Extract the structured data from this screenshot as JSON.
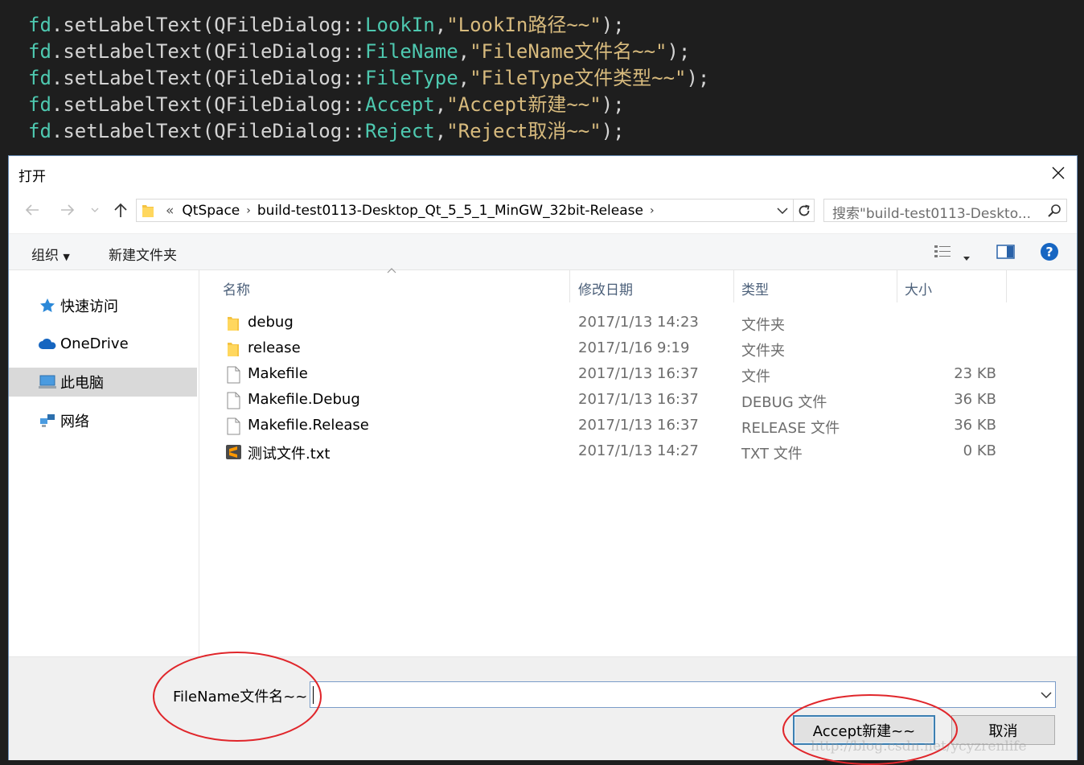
{
  "code": {
    "lines": [
      {
        "obj": "fd",
        "fn": ".setLabelText(",
        "cls": "QFileDialog::",
        "enum": "LookIn",
        "str": "\"LookIn路径~~\"",
        "end": ");"
      },
      {
        "obj": "fd",
        "fn": ".setLabelText(",
        "cls": "QFileDialog::",
        "enum": "FileName",
        "str": "\"FileName文件名~~\"",
        "end": ");"
      },
      {
        "obj": "fd",
        "fn": ".setLabelText(",
        "cls": "QFileDialog::",
        "enum": "FileType",
        "str": "\"FileType文件类型~~\"",
        "end": ");"
      },
      {
        "obj": "fd",
        "fn": ".setLabelText(",
        "cls": "QFileDialog::",
        "enum": "Accept",
        "str": "\"Accept新建~~\"",
        "end": ");"
      },
      {
        "obj": "fd",
        "fn": ".setLabelText(",
        "cls": "QFileDialog::",
        "enum": "Reject",
        "str": "\"Reject取消~~\"",
        "end": ");"
      }
    ]
  },
  "dialog": {
    "title": "打开",
    "address": {
      "overflow": "«",
      "segments": [
        "QtSpace",
        "build-test0113-Desktop_Qt_5_5_1_MinGW_32bit-Release"
      ]
    },
    "search_placeholder": "搜索\"build-test0113-Deskto...",
    "toolbar": {
      "organize": "组织",
      "new_folder": "新建文件夹"
    },
    "nav": [
      {
        "label": "快速访问",
        "icon": "star-icon"
      },
      {
        "label": "OneDrive",
        "icon": "cloud-icon"
      },
      {
        "label": "此电脑",
        "icon": "computer-icon",
        "selected": true
      },
      {
        "label": "网络",
        "icon": "network-icon"
      }
    ],
    "columns": {
      "name": "名称",
      "date": "修改日期",
      "type": "类型",
      "size": "大小"
    },
    "files": [
      {
        "name": "debug",
        "date": "2017/1/13 14:23",
        "type": "文件夹",
        "size": "",
        "icon": "folder-icon"
      },
      {
        "name": "release",
        "date": "2017/1/16 9:19",
        "type": "文件夹",
        "size": "",
        "icon": "folder-icon"
      },
      {
        "name": "Makefile",
        "date": "2017/1/13 16:37",
        "type": "文件",
        "size": "23 KB",
        "icon": "file-icon"
      },
      {
        "name": "Makefile.Debug",
        "date": "2017/1/13 16:37",
        "type": "DEBUG 文件",
        "size": "36 KB",
        "icon": "file-icon"
      },
      {
        "name": "Makefile.Release",
        "date": "2017/1/13 16:37",
        "type": "RELEASE 文件",
        "size": "36 KB",
        "icon": "file-icon"
      },
      {
        "name": "测试文件.txt",
        "date": "2017/1/13 14:27",
        "type": "TXT 文件",
        "size": "0 KB",
        "icon": "sublime-text-icon"
      }
    ],
    "filename_label": "FileName文件名~~",
    "filename_value": "",
    "accept_label": "Accept新建~~",
    "reject_label": "取消"
  },
  "watermark": "http://blog.csdn.net/ycyzrenlife",
  "colors": {
    "annotation": "#e0262b",
    "accent": "#0078d7"
  }
}
